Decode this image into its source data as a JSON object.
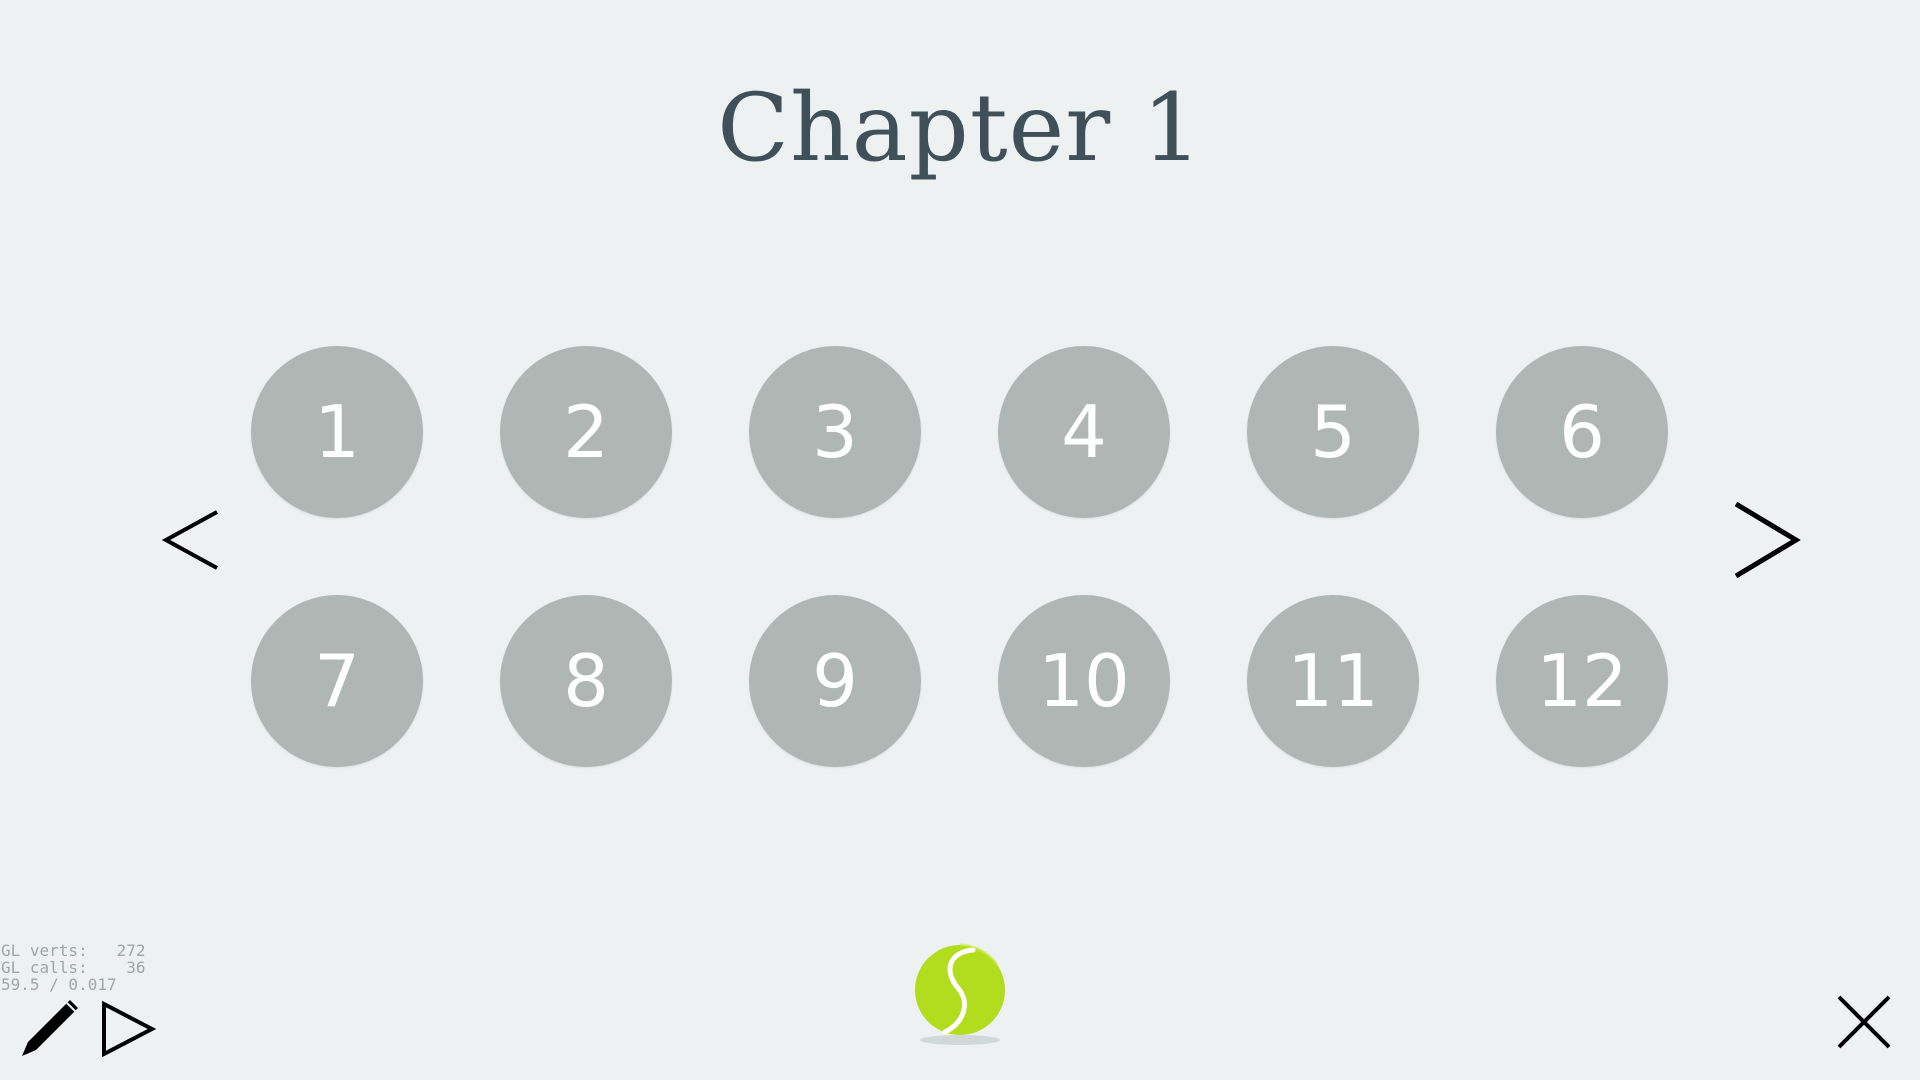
{
  "title": "Chapter 1",
  "levels": [
    "1",
    "2",
    "3",
    "4",
    "5",
    "6",
    "7",
    "8",
    "9",
    "10",
    "11",
    "12"
  ],
  "nav": {
    "prev_icon": "chevron-left-icon",
    "next_icon": "chevron-right-icon"
  },
  "debug": {
    "line1": "GL verts:   272",
    "line2": "GL calls:    36",
    "line3": "59.5 / 0.017"
  },
  "toolbar": {
    "edit_icon": "pencil-icon",
    "play_icon": "play-icon",
    "close_icon": "close-icon"
  },
  "logo": {
    "icon": "tennis-ball-icon",
    "color": "#b2dc1e"
  },
  "colors": {
    "background": "#edf1f2",
    "level_circle": "#b0b6b4",
    "title": "#3f5058"
  }
}
